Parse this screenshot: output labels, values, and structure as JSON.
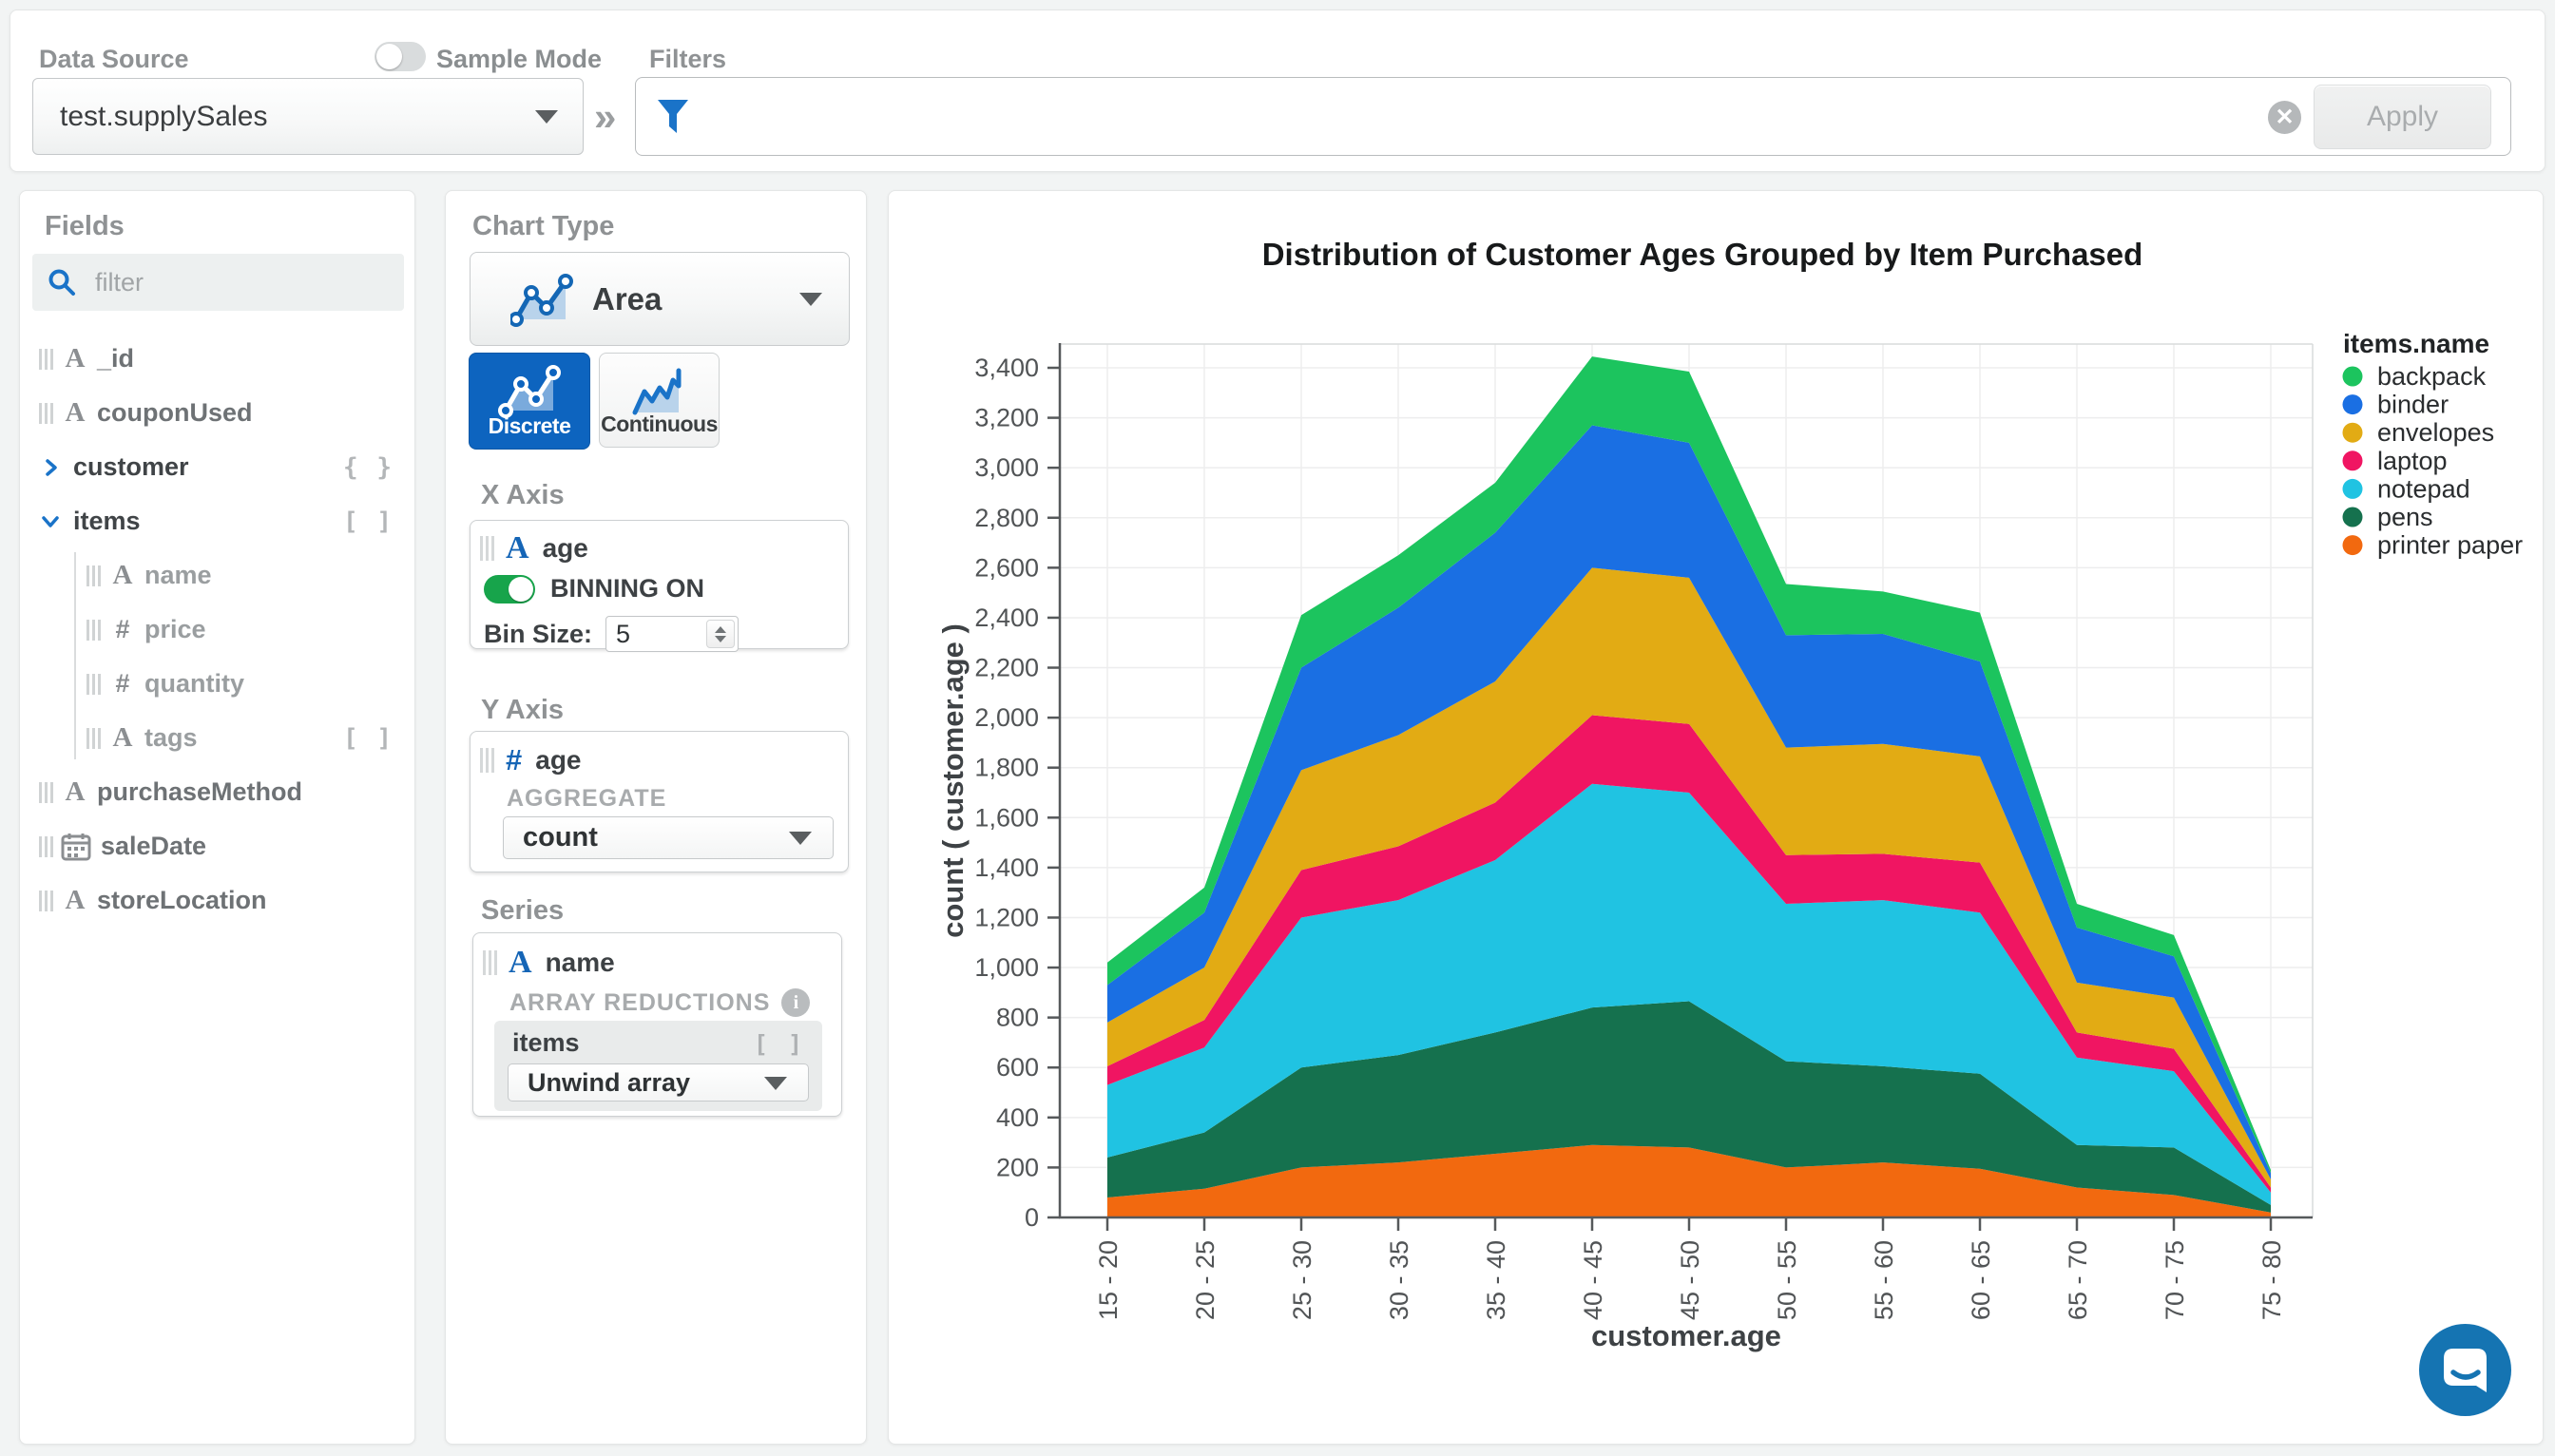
{
  "toolbar": {
    "data_source_label": "Data Source",
    "data_source_value": "test.supplySales",
    "sample_mode_label": "Sample Mode",
    "filters_label": "Filters",
    "apply_label": "Apply"
  },
  "fields_panel": {
    "title": "Fields",
    "filter_placeholder": "filter",
    "items": [
      {
        "name": "_id",
        "type": "string",
        "level": 0
      },
      {
        "name": "couponUsed",
        "type": "string",
        "level": 0
      },
      {
        "name": "customer",
        "type": "object",
        "level": 0,
        "expandable": true,
        "expanded": false,
        "badge": "{ }"
      },
      {
        "name": "items",
        "type": "array",
        "level": 0,
        "expandable": true,
        "expanded": true,
        "badge": "[ ]"
      },
      {
        "name": "name",
        "type": "string",
        "level": 1
      },
      {
        "name": "price",
        "type": "number",
        "level": 1
      },
      {
        "name": "quantity",
        "type": "number",
        "level": 1
      },
      {
        "name": "tags",
        "type": "string",
        "level": 1,
        "badge": "[ ]"
      },
      {
        "name": "purchaseMethod",
        "type": "string",
        "level": 0
      },
      {
        "name": "saleDate",
        "type": "date",
        "level": 0
      },
      {
        "name": "storeLocation",
        "type": "string",
        "level": 0
      }
    ]
  },
  "encode_panel": {
    "chart_type_label": "Chart Type",
    "chart_type_value": "Area",
    "discrete_label": "Discrete",
    "continuous_label": "Continuous",
    "x_axis": {
      "heading": "X Axis",
      "field": "age",
      "field_type": "string",
      "binning_label": "BINNING ON",
      "bin_size_label": "Bin Size:",
      "bin_size_value": "5"
    },
    "y_axis": {
      "heading": "Y Axis",
      "field": "age",
      "field_type": "number",
      "aggregate_label": "AGGREGATE",
      "aggregate_value": "count"
    },
    "series": {
      "heading": "Series",
      "field": "name",
      "field_type": "string",
      "array_reductions_label": "ARRAY REDUCTIONS",
      "array_field": "items",
      "array_field_badge": "[ ]",
      "reduction_value": "Unwind array"
    }
  },
  "chart_data": {
    "type": "area",
    "stacked": true,
    "title": "Distribution of Customer Ages Grouped by Item Purchased",
    "xlabel": "customer.age",
    "ylabel": "count ( customer.age )",
    "legend_title": "items.name",
    "legend_position": "right",
    "grid": true,
    "categories": [
      "15 - 20",
      "20 - 25",
      "25 - 30",
      "30 - 35",
      "35 - 40",
      "40 - 45",
      "45 - 50",
      "50 - 55",
      "55 - 60",
      "60 - 65",
      "65 - 70",
      "70 - 75",
      "75 - 80"
    ],
    "ylim": [
      0,
      3495
    ],
    "y_ticks": [
      0,
      200,
      400,
      600,
      800,
      1000,
      1200,
      1400,
      1600,
      1800,
      2000,
      2200,
      2400,
      2600,
      2800,
      3000,
      3200,
      3400
    ],
    "series": [
      {
        "name": "printer paper",
        "color": "#f2690f",
        "values": [
          80,
          115,
          200,
          220,
          255,
          290,
          280,
          200,
          220,
          195,
          120,
          90,
          20
        ]
      },
      {
        "name": "pens",
        "color": "#15714e",
        "values": [
          160,
          225,
          400,
          430,
          485,
          550,
          585,
          425,
          385,
          380,
          170,
          190,
          30
        ]
      },
      {
        "name": "notepad",
        "color": "#20c3e2",
        "values": [
          290,
          340,
          600,
          620,
          690,
          895,
          835,
          630,
          665,
          645,
          350,
          305,
          50
        ]
      },
      {
        "name": "laptop",
        "color": "#f01562",
        "values": [
          75,
          110,
          190,
          215,
          230,
          275,
          275,
          195,
          185,
          200,
          100,
          90,
          20
        ]
      },
      {
        "name": "envelopes",
        "color": "#e2ab14",
        "values": [
          175,
          210,
          400,
          445,
          485,
          590,
          585,
          430,
          440,
          425,
          200,
          205,
          32
        ]
      },
      {
        "name": "binder",
        "color": "#1a6fe3",
        "values": [
          150,
          220,
          410,
          510,
          595,
          570,
          540,
          450,
          440,
          380,
          220,
          165,
          26
        ]
      },
      {
        "name": "backpack",
        "color": "#1cc45e",
        "values": [
          90,
          100,
          210,
          210,
          200,
          275,
          285,
          205,
          170,
          195,
          95,
          85,
          12
        ]
      }
    ],
    "legend_order": [
      "backpack",
      "binder",
      "envelopes",
      "laptop",
      "notepad",
      "pens",
      "printer paper"
    ]
  },
  "icons": {
    "collapse_chevrons": "»",
    "clear_filter": "✕",
    "info": "i"
  },
  "intercom": {
    "name": "chat launcher"
  }
}
